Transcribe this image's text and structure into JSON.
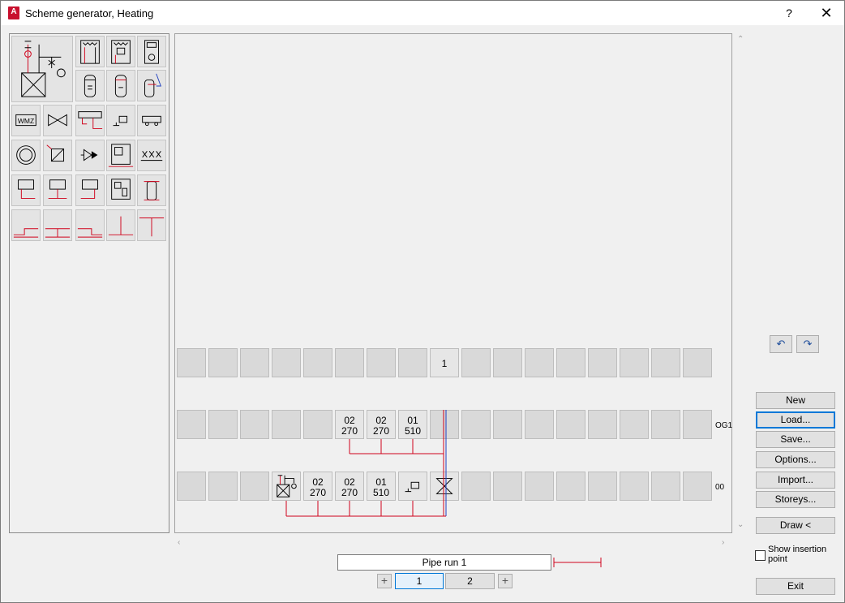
{
  "window": {
    "title": "Scheme generator, Heating",
    "app_icon_letter": "A",
    "help_glyph": "?",
    "close_glyph": "✕"
  },
  "grid": {
    "top_row_label": "1",
    "row_og1_tag": "OG1",
    "row_00_tag": "00",
    "og1_cells": [
      {
        "line1": "02",
        "line2": "270"
      },
      {
        "line1": "02",
        "line2": "270"
      },
      {
        "line1": "01",
        "line2": "510"
      }
    ],
    "eg_cells": [
      {
        "line1": "02",
        "line2": "270"
      },
      {
        "line1": "02",
        "line2": "270"
      },
      {
        "line1": "01",
        "line2": "510"
      }
    ]
  },
  "buttons": {
    "new": "New",
    "load": "Load...",
    "save": "Save...",
    "options": "Options...",
    "import": "Import...",
    "storeys": "Storeys...",
    "draw": "Draw <",
    "exit": "Exit",
    "undo_glyph": "↶",
    "redo_glyph": "↷"
  },
  "pipe_run": {
    "value": "Pipe run 1",
    "tabs": [
      "1",
      "2"
    ],
    "plus": "+"
  },
  "options": {
    "show_insertion_point": "Show insertion point"
  },
  "colors": {
    "pipe_red": "#d0021b",
    "pipe_blue": "#1f3fbf",
    "accent": "#0078d7"
  }
}
